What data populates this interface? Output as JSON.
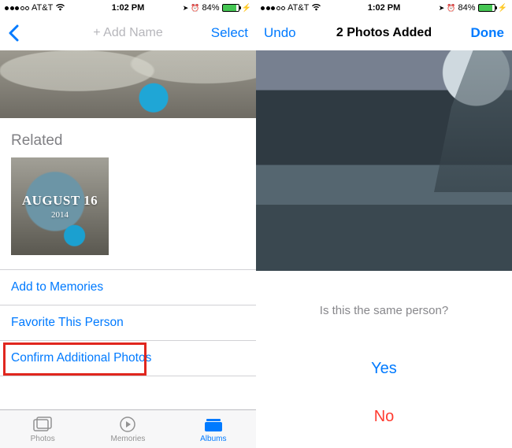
{
  "status": {
    "carrier": "AT&T",
    "time": "1:02 PM",
    "battery_pct": "84%"
  },
  "left": {
    "nav": {
      "title": "+ Add Name",
      "select": "Select"
    },
    "section_title": "Related",
    "related": {
      "date": "AUGUST 16",
      "year": "2014"
    },
    "actions": {
      "add_memories": "Add to Memories",
      "favorite": "Favorite This Person",
      "confirm": "Confirm Additional Photos"
    },
    "tabs": {
      "photos": "Photos",
      "memories": "Memories",
      "albums": "Albums"
    }
  },
  "right": {
    "nav": {
      "undo": "Undo",
      "title": "2 Photos Added",
      "done": "Done"
    },
    "prompt": "Is this the same person?",
    "yes": "Yes",
    "no": "No"
  }
}
